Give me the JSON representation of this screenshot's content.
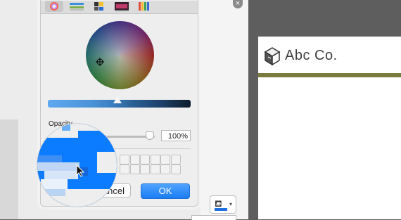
{
  "picker": {
    "opacity_label": "Opacity",
    "opacity_value": "100%",
    "cancel_label": "Cancel",
    "ok_label": "OK",
    "tabs": [
      "color-wheel",
      "color-sliders",
      "color-palettes",
      "image-palettes",
      "pencils"
    ]
  },
  "brand": {
    "name": "Abc Co."
  },
  "colors": {
    "accent": "#1a7cf4",
    "stripe": "#7b7b3e",
    "selected": "#0b7cff"
  },
  "close_glyph": "×",
  "bucket_glyph": "⛾"
}
